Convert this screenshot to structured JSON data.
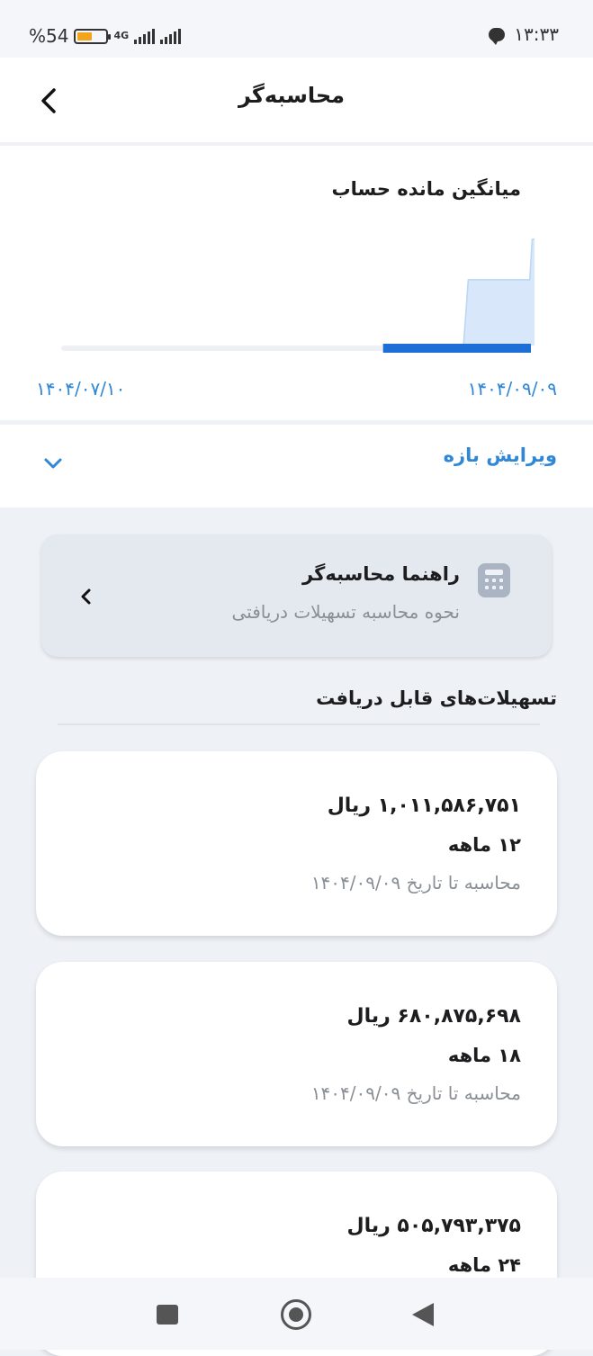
{
  "status_bar": {
    "battery_text": "%54",
    "battery_level": 0.54,
    "network": "4G",
    "time": "۱۳:۳۳"
  },
  "header": {
    "title": "محاسبه‌گر",
    "back_icon": "chevron-left-icon"
  },
  "chart": {
    "title": "میانگین مانده حساب",
    "date_start": "۱۴۰۴/۰۷/۱۰",
    "date_end": "۱۴۰۴/۰۹/۰۹",
    "accent_color": "#1c6fd6",
    "area_color": "#d8e8fa",
    "track_color": "#eef0f3"
  },
  "chart_data": {
    "type": "area",
    "x_range": [
      "۱۴۰۴/۰۷/۱۰",
      "۱۴۰۴/۰۹/۰۹"
    ],
    "y_unit_label": "",
    "series": [
      {
        "values": [
          {
            "x": 0.85,
            "y": 0.0
          },
          {
            "x": 0.86,
            "y": 0.62
          },
          {
            "x": 0.88,
            "y": 0.62
          },
          {
            "x": 0.99,
            "y": 0.62
          },
          {
            "x": 0.995,
            "y": 1.0
          },
          {
            "x": 1.0,
            "y": 1.0
          }
        ]
      }
    ],
    "selected_range": [
      0.68,
      1.0
    ],
    "grid": false,
    "legend": "none"
  },
  "edit_range": {
    "label": "ویرایش بازه",
    "icon": "chevron-down-icon"
  },
  "guide": {
    "title": "راهنما محاسبه‌گر",
    "subtitle": "نحوه محاسبه تسهیلات دریافتی",
    "icon": "calculator-icon",
    "chevron_icon": "chevron-left-icon"
  },
  "loans_section": {
    "title": "تسهیلات‌های قابل دریافت",
    "items": [
      {
        "amount": "۱,۰۱۱,۵۸۶,۷۵۱ ریال",
        "term": "۱۲ ماهه",
        "calc_note": "محاسبه تا تاریخ ۱۴۰۴/۰۹/۰۹"
      },
      {
        "amount": "۶۸۰,۸۷۵,۶۹۸ ریال",
        "term": "۱۸ ماهه",
        "calc_note": "محاسبه تا تاریخ ۱۴۰۴/۰۹/۰۹"
      },
      {
        "amount": "۵۰۵,۷۹۳,۳۷۵ ریال",
        "term": "۲۴ ماهه",
        "calc_note": ""
      }
    ]
  },
  "nav_bar": {
    "recents_icon": "square-icon",
    "home_icon": "circle-home-icon",
    "back_icon": "triangle-back-icon"
  }
}
